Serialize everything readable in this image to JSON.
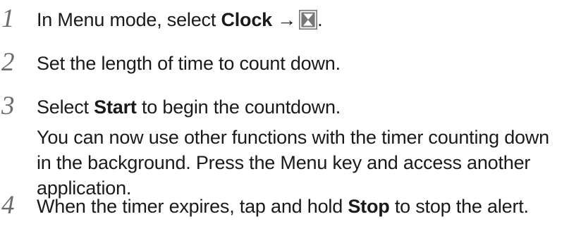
{
  "steps": [
    {
      "number": "1",
      "before": "In Menu mode, select ",
      "bold": "Clock",
      "arrow": "→",
      "icon": "hourglass-icon",
      "after": "."
    },
    {
      "number": "2",
      "text": "Set the length of time to count down."
    },
    {
      "number": "3",
      "before": "Select ",
      "bold": "Start",
      "after": " to begin the countdown.",
      "note": "You can now use other functions with the timer counting down in the background. Press the Menu key and access another application."
    },
    {
      "number": "4",
      "before": "When the timer expires, tap and hold ",
      "bold": "Stop",
      "after": " to stop the alert."
    }
  ],
  "colors": {
    "text": "#1a1a1a",
    "step_number": "#6b6b6b",
    "icon_fill": "#777777"
  }
}
